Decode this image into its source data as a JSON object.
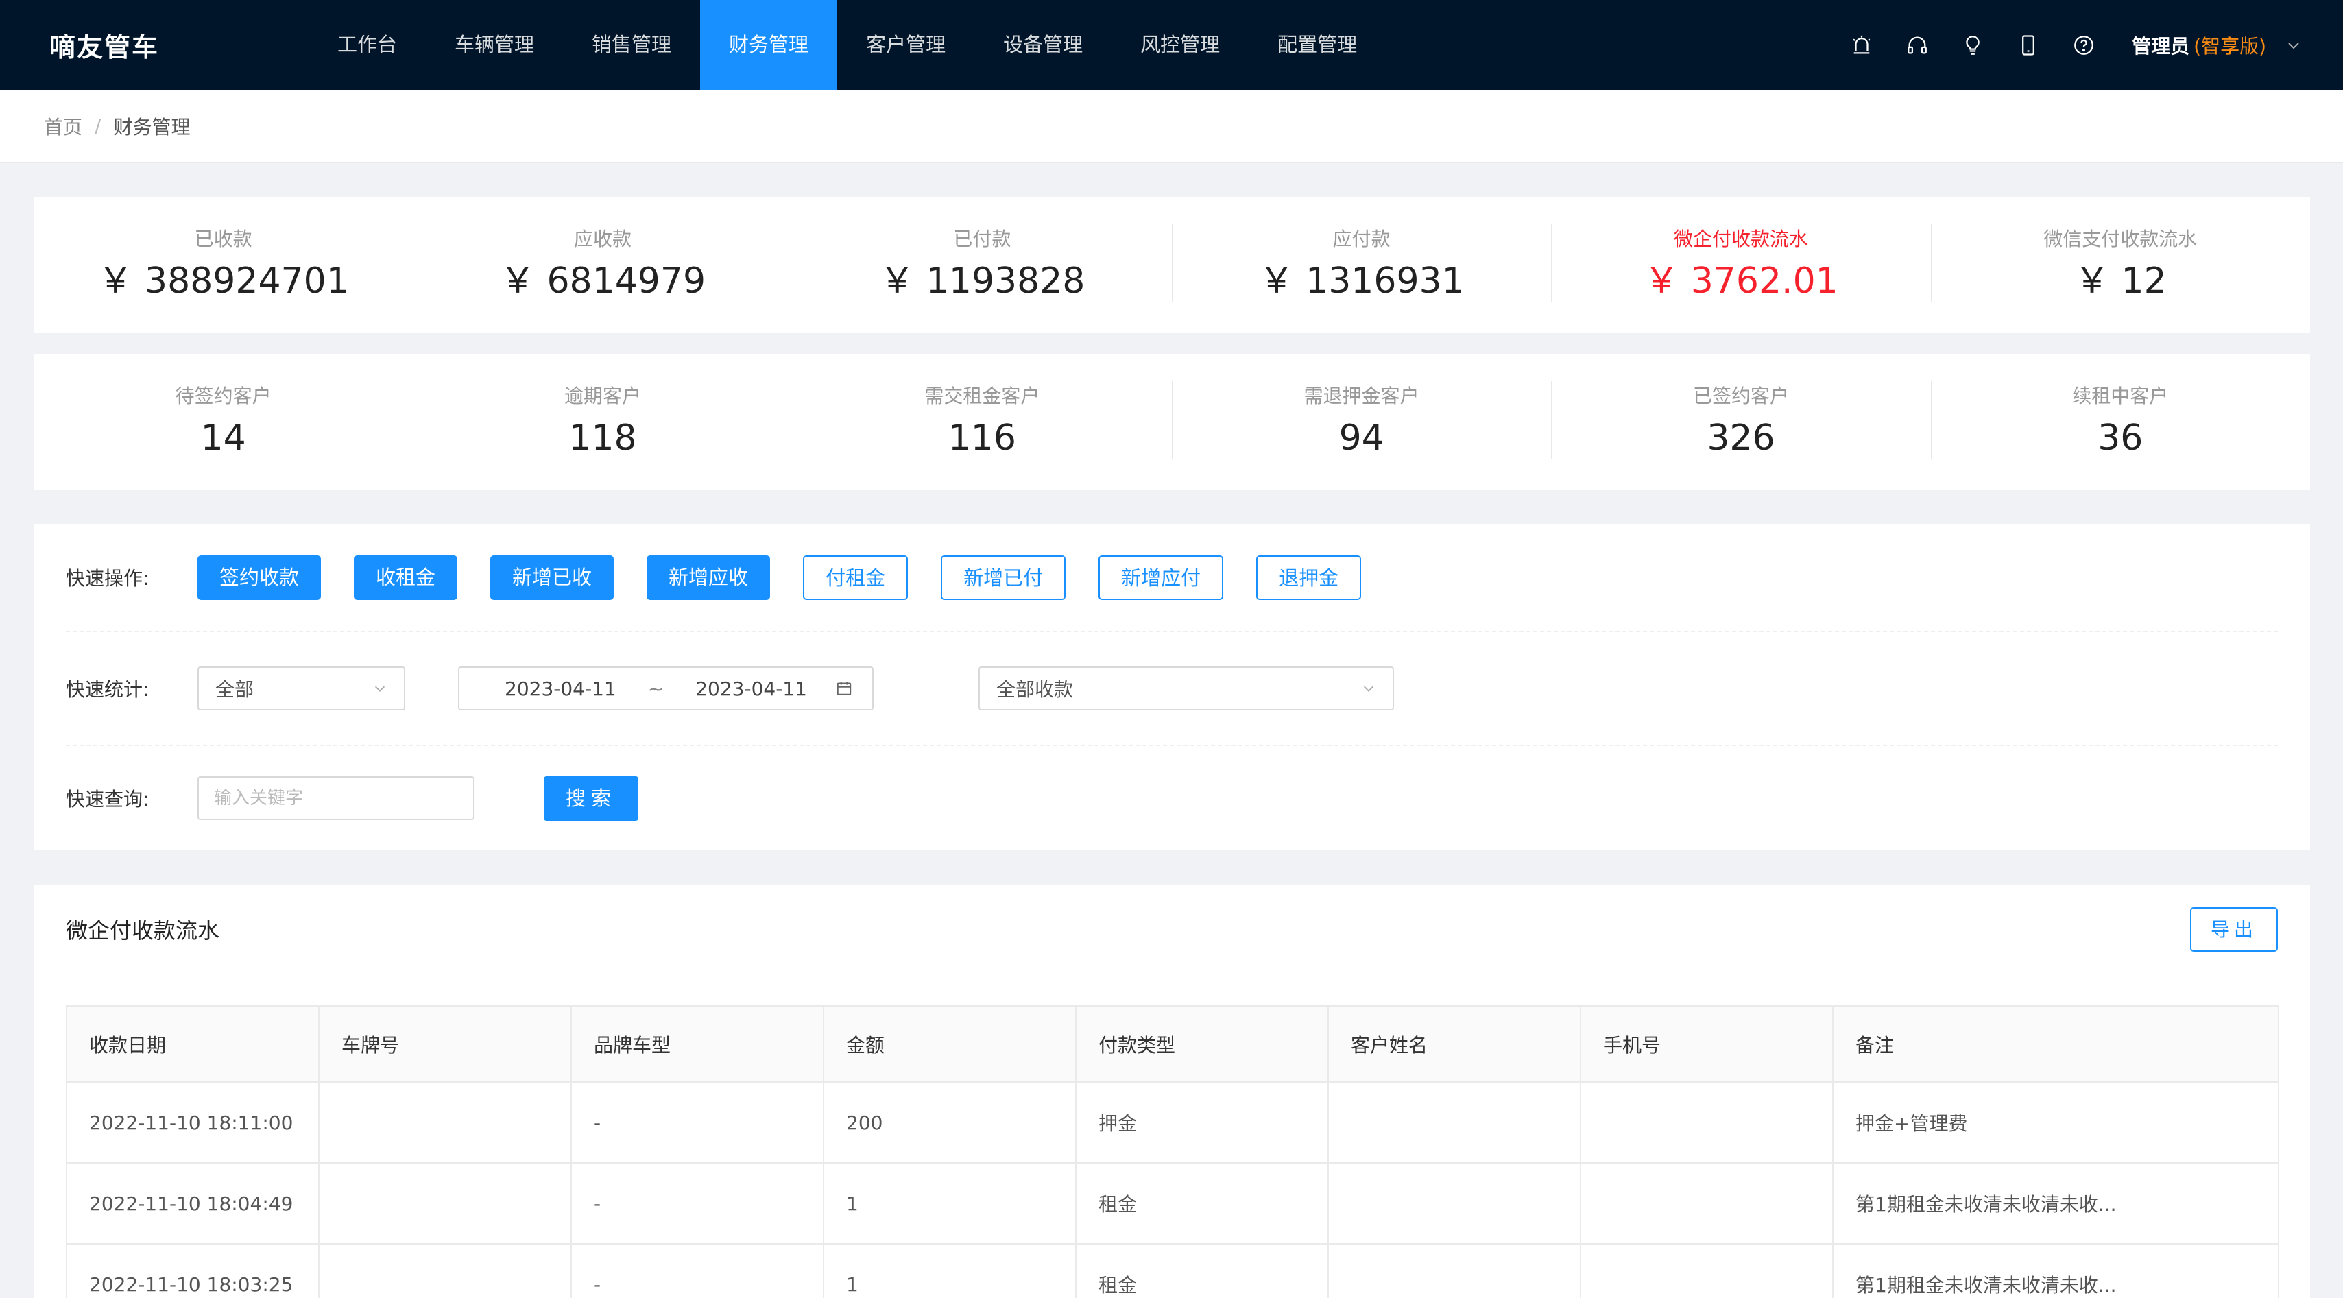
{
  "app": {
    "logo": "嘀友管车",
    "nav": [
      "工作台",
      "车辆管理",
      "销售管理",
      "财务管理",
      "客户管理",
      "设备管理",
      "风控管理",
      "配置管理"
    ],
    "nav_active": 3,
    "user_name": "管理员",
    "user_edition": "(智享版)",
    "icons": [
      "alarm-icon",
      "headset-icon",
      "bulb-icon",
      "mobile-icon",
      "help-icon"
    ]
  },
  "breadcrumb": {
    "home": "首页",
    "separator": "/",
    "current": "财务管理"
  },
  "stats_row1": [
    {
      "label": "已收款",
      "value": "￥ 388924701"
    },
    {
      "label": "应收款",
      "value": "￥ 6814979"
    },
    {
      "label": "已付款",
      "value": "￥ 1193828"
    },
    {
      "label": "应付款",
      "value": "￥ 1316931"
    },
    {
      "label": "微企付收款流水",
      "value": "￥ 3762.01",
      "highlight": true
    },
    {
      "label": "微信支付收款流水",
      "value": "￥ 12"
    }
  ],
  "stats_row2": [
    {
      "label": "待签约客户",
      "value": "14"
    },
    {
      "label": "逾期客户",
      "value": "118"
    },
    {
      "label": "需交租金客户",
      "value": "116"
    },
    {
      "label": "需退押金客户",
      "value": "94"
    },
    {
      "label": "已签约客户",
      "value": "326"
    },
    {
      "label": "续租中客户",
      "value": "36"
    }
  ],
  "quick_ops": {
    "label": "快速操作:",
    "buttons": [
      {
        "text": "签约收款",
        "style": "primary"
      },
      {
        "text": "收租金",
        "style": "primary"
      },
      {
        "text": "新增已收",
        "style": "primary"
      },
      {
        "text": "新增应收",
        "style": "primary"
      },
      {
        "text": "付租金",
        "style": "ghost"
      },
      {
        "text": "新增已付",
        "style": "ghost"
      },
      {
        "text": "新增应付",
        "style": "ghost"
      },
      {
        "text": "退押金",
        "style": "ghost"
      }
    ]
  },
  "quick_stats": {
    "label": "快速统计:",
    "scope_select": "全部",
    "date_start": "2023-04-11",
    "date_sep": "~",
    "date_end": "2023-04-11",
    "type_select": "全部收款"
  },
  "quick_search": {
    "label": "快速查询:",
    "placeholder": "输入关键字",
    "value": "",
    "button": "搜索"
  },
  "table": {
    "title": "微企付收款流水",
    "export": "导出",
    "columns": [
      "收款日期",
      "车牌号",
      "品牌车型",
      "金额",
      "付款类型",
      "客户姓名",
      "手机号",
      "备注"
    ],
    "rows": [
      [
        "2022-11-10 18:11:00",
        "",
        "-",
        "200",
        "押金",
        "",
        "",
        "押金+管理费"
      ],
      [
        "2022-11-10 18:04:49",
        "",
        "-",
        "1",
        "租金",
        "",
        "",
        "第1期租金未收清未收清未收..."
      ],
      [
        "2022-11-10 18:03:25",
        "",
        "-",
        "1",
        "租金",
        "",
        "",
        "第1期租金未收清未收清未收..."
      ]
    ]
  },
  "colors": {
    "nav_bg": "#001529",
    "accent": "#1890ff",
    "danger": "#f5222d",
    "edition": "#fa8c16"
  }
}
